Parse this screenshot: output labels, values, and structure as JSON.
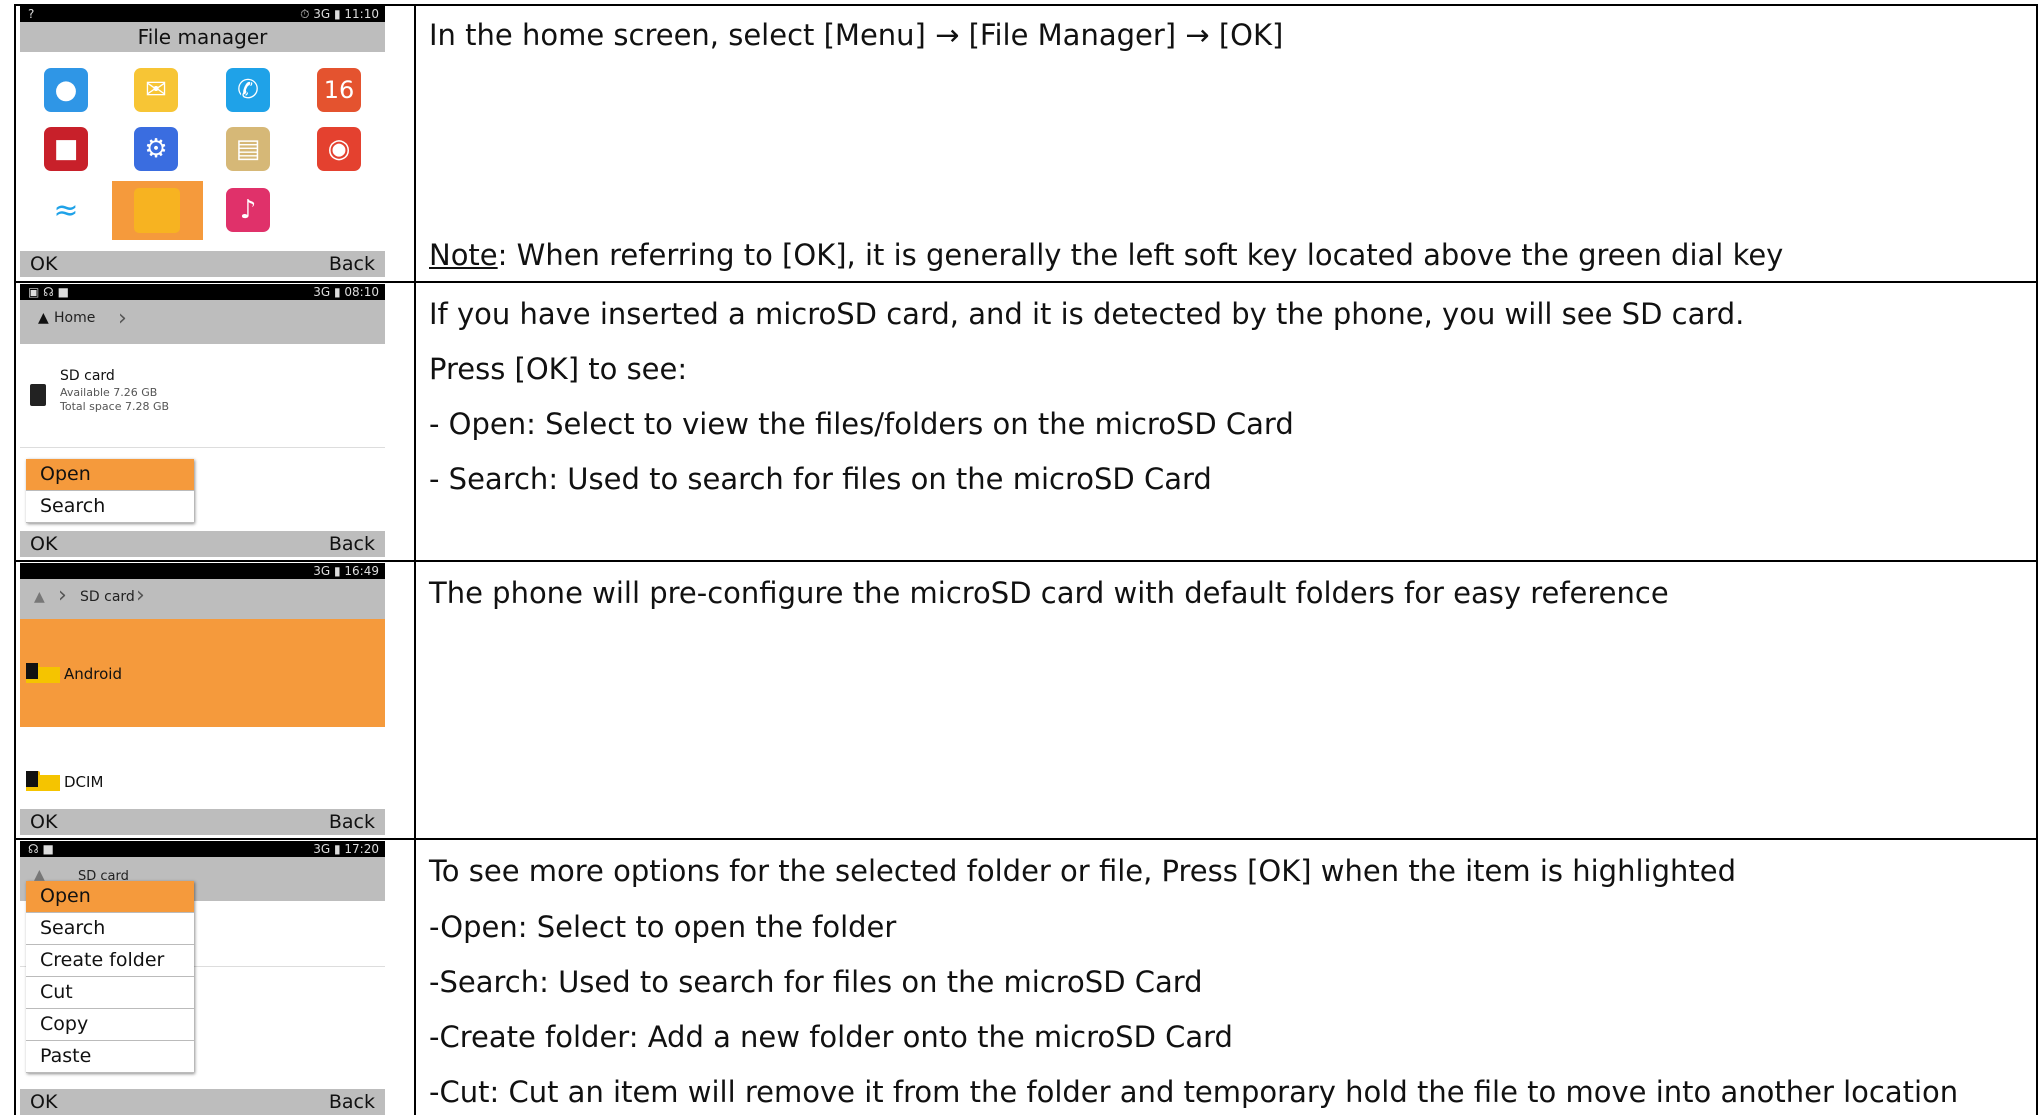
{
  "rows": [
    {
      "phone": {
        "status_time": "⏱ 3G ▮ 11:10",
        "header_title": "File manager",
        "ok": "OK",
        "back": "Back"
      },
      "line1": "In the home screen, select [Menu] → [File Manager] → [OK]",
      "note_label": "Note",
      "note_text": ": When referring to [OK], it is generally the left soft key located above the green dial key"
    },
    {
      "phone": {
        "status_time": "3G ▮ 08:10",
        "crumb": "Home",
        "item_title": "SD card",
        "item_available": "Available 7.26 GB",
        "item_total": "Total space 7.28 GB",
        "menu": [
          "Open",
          "Search"
        ],
        "ok": "OK",
        "back": "Back"
      },
      "lines": [
        "If you have inserted a microSD card, and it is detected by the phone, you will see SD card.",
        "Press [OK] to see:",
        "- Open: Select to view the files/folders on the microSD Card",
        "- Search: Used to search for files on the microSD Card"
      ]
    },
    {
      "phone": {
        "status_time": "3G ▮ 16:49",
        "crumb": "SD card",
        "folder1": "Android",
        "folder2": "DCIM",
        "ok": "OK",
        "back": "Back"
      },
      "lines": [
        "The phone will pre-configure the microSD card with default folders for easy reference"
      ]
    },
    {
      "phone": {
        "status_time": "3G ▮ 17:20",
        "crumb": "SD card",
        "menu": [
          "Open",
          "Search",
          "Create folder",
          "Cut",
          "Copy",
          "Paste"
        ],
        "ok": "OK",
        "back": "Back"
      },
      "lines": [
        "To see more options for the selected folder or file, Press [OK] when the item is highlighted",
        "-Open: Select to open the folder",
        "-Search: Used to search for files on the microSD Card",
        "-Create folder: Add a new folder onto the microSD Card",
        "-Cut: Cut an item will remove it from the folder and temporary hold the file to move into another location"
      ]
    }
  ],
  "colors": {
    "highlight": "#f59a3c",
    "softkey_bar": "#bdbdbd",
    "folder": "#f5c400"
  }
}
